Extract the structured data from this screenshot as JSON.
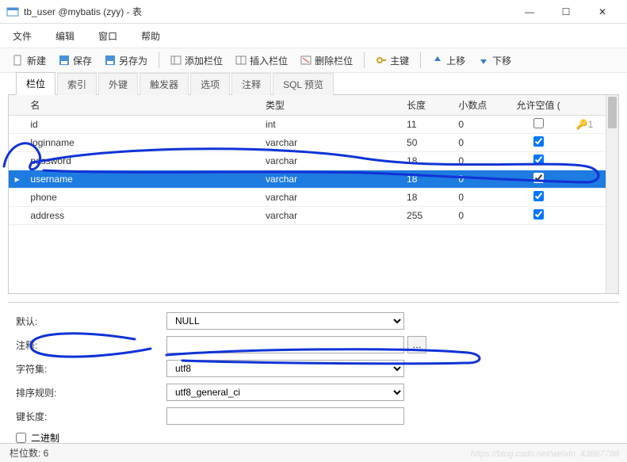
{
  "window": {
    "title": "tb_user @mybatis (zyy) - 表",
    "min": "—",
    "max": "☐",
    "close": "✕"
  },
  "menu": {
    "file": "文件",
    "edit": "编辑",
    "window": "窗口",
    "help": "帮助"
  },
  "toolbar": {
    "new": "新建",
    "save": "保存",
    "saveas": "另存为",
    "addcol": "添加栏位",
    "insertcol": "插入栏位",
    "delcol": "删除栏位",
    "pk": "主键",
    "up": "上移",
    "down": "下移"
  },
  "tabs": {
    "fields": "栏位",
    "index": "索引",
    "fk": "外键",
    "trigger": "触发器",
    "option": "选项",
    "comment": "注释",
    "sqlpreview": "SQL 预览"
  },
  "headers": {
    "name": "名",
    "type": "类型",
    "len": "长度",
    "dec": "小数点",
    "null": "允许空值 ("
  },
  "rows": [
    {
      "name": "id",
      "type": "int",
      "len": "11",
      "dec": "0",
      "null": false,
      "key": "1",
      "selected": false
    },
    {
      "name": "loginname",
      "type": "varchar",
      "len": "50",
      "dec": "0",
      "null": true,
      "key": "",
      "selected": false
    },
    {
      "name": "password",
      "type": "varchar",
      "len": "18",
      "dec": "0",
      "null": true,
      "key": "",
      "selected": false
    },
    {
      "name": "username",
      "type": "varchar",
      "len": "18",
      "dec": "0",
      "null": true,
      "key": "",
      "selected": true
    },
    {
      "name": "phone",
      "type": "varchar",
      "len": "18",
      "dec": "0",
      "null": true,
      "key": "",
      "selected": false
    },
    {
      "name": "address",
      "type": "varchar",
      "len": "255",
      "dec": "0",
      "null": true,
      "key": "",
      "selected": false
    }
  ],
  "props": {
    "default_lbl": "默认:",
    "default_val": "NULL",
    "comment_lbl": "注释:",
    "comment_val": "",
    "charset_lbl": "字符集:",
    "charset_val": "utf8",
    "collation_lbl": "排序规则:",
    "collation_val": "utf8_general_ci",
    "keylen_lbl": "键长度:",
    "keylen_val": "",
    "binary_lbl": "二进制"
  },
  "status": {
    "text": "栏位数: 6"
  },
  "watermark": "https://blog.csdn.net/weixin_43867788"
}
